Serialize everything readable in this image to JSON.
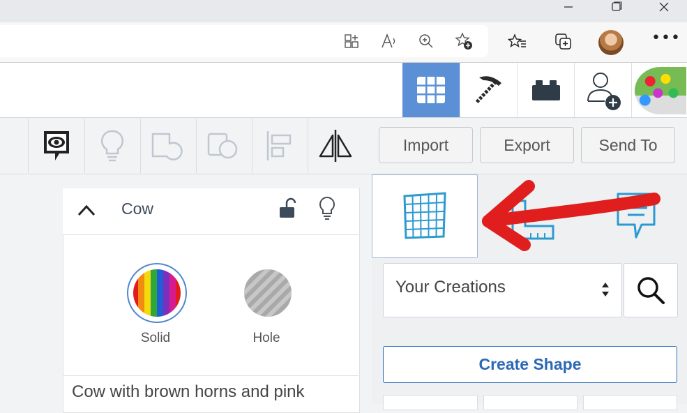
{
  "browser": {
    "window_controls": [
      "minimize",
      "restore",
      "close"
    ],
    "address_icons": [
      "apps-icon",
      "read-aloud-icon",
      "zoom-icon",
      "add-favorite-icon"
    ],
    "toolbar_icons": [
      "favorites-icon",
      "collections-icon",
      "profile-avatar",
      "more-icon"
    ]
  },
  "app_nav": {
    "items": [
      "3D Design",
      "Minecraft",
      "Bricks",
      "Invite User",
      "Profile"
    ],
    "active": "3D Design"
  },
  "tools": {
    "icons": [
      "notes-icon",
      "hint-icon",
      "group-icon",
      "ungroup-icon",
      "align-icon",
      "mirror-icon"
    ],
    "import_label": "Import",
    "export_label": "Export",
    "send_label": "Send To"
  },
  "inspector": {
    "title": "Cow",
    "solid_label": "Solid",
    "hole_label": "Hole",
    "description": "Cow with brown horns and pink"
  },
  "right_panel": {
    "library_label": "Your Creations",
    "create_label": "Create Shape"
  },
  "colors": {
    "accent": "#5b8fd6",
    "link": "#2b68b5",
    "annotation": "#e01e1e"
  }
}
